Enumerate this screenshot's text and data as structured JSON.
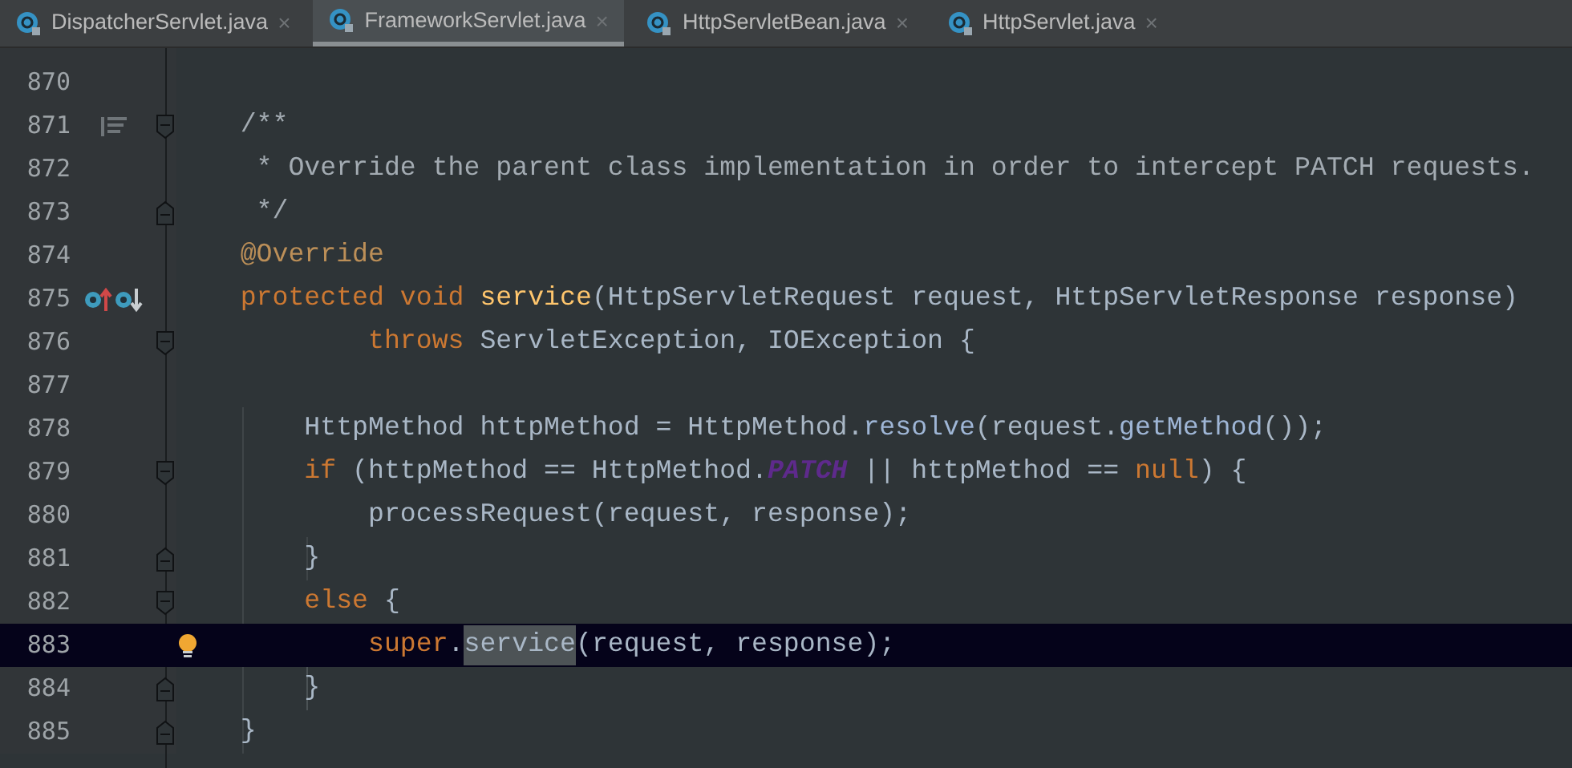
{
  "tabs": [
    {
      "label": "DispatcherServlet.java",
      "selected": false,
      "close": "×"
    },
    {
      "label": "FrameworkServlet.java",
      "selected": true,
      "close": "×"
    },
    {
      "label": "HttpServletBean.java",
      "selected": false,
      "close": "×"
    },
    {
      "label": "HttpServlet.java",
      "selected": false,
      "close": "×"
    }
  ],
  "lines": [
    {
      "number": "870",
      "current": false
    },
    {
      "number": "871",
      "current": false,
      "fold": {
        "kind": "start"
      },
      "gutter_icons": [
        {
          "kind": "doc"
        }
      ],
      "tokens": [
        {
          "text": "    /**",
          "kind": "comment"
        }
      ]
    },
    {
      "number": "872",
      "current": false,
      "tokens": [
        {
          "text": "     * Override the parent class implementation in order to intercept PATCH requests.",
          "kind": "comment"
        }
      ]
    },
    {
      "number": "873",
      "current": false,
      "fold": {
        "kind": "end"
      },
      "tokens": [
        {
          "text": "     */",
          "kind": "comment"
        }
      ]
    },
    {
      "number": "874",
      "current": false,
      "tokens": [
        {
          "text": "    @Override",
          "kind": "annotation"
        }
      ]
    },
    {
      "number": "875",
      "current": false,
      "gutter_icons": [
        {
          "kind": "overriding"
        },
        {
          "kind": "overridden"
        }
      ],
      "tokens": [
        {
          "text": "    protected void ",
          "kind": "keyword"
        },
        {
          "text": "service",
          "kind": "declaration"
        },
        {
          "text": "(HttpServletRequest request, HttpServletResponse response)",
          "kind": "plain"
        }
      ]
    },
    {
      "number": "876",
      "current": false,
      "fold": {
        "kind": "start"
      },
      "tokens": [
        {
          "text": "            throws ",
          "kind": "keyword"
        },
        {
          "text": "ServletException, IOException {",
          "kind": "plain"
        }
      ]
    },
    {
      "number": "877",
      "current": false
    },
    {
      "number": "878",
      "current": false,
      "tokens": [
        {
          "text": "        HttpMethod httpMethod = HttpMethod.",
          "kind": "plain"
        },
        {
          "text": "resolve",
          "kind": "call"
        },
        {
          "text": "(request.",
          "kind": "plain"
        },
        {
          "text": "getMethod",
          "kind": "call"
        },
        {
          "text": "());",
          "kind": "plain"
        }
      ]
    },
    {
      "number": "879",
      "current": false,
      "fold": {
        "kind": "start"
      },
      "tokens": [
        {
          "text": "        if ",
          "kind": "keyword"
        },
        {
          "text": "(httpMethod == HttpMethod.",
          "kind": "plain"
        },
        {
          "text": "PATCH",
          "kind": "constant"
        },
        {
          "text": " || httpMethod == ",
          "kind": "plain"
        },
        {
          "text": "null",
          "kind": "keyword"
        },
        {
          "text": ") {",
          "kind": "plain"
        }
      ]
    },
    {
      "number": "880",
      "current": false,
      "tokens": [
        {
          "text": "            processRequest(request, response);",
          "kind": "plain"
        }
      ]
    },
    {
      "number": "881",
      "current": false,
      "fold": {
        "kind": "end"
      },
      "tokens": [
        {
          "text": "        }",
          "kind": "plain"
        }
      ]
    },
    {
      "number": "882",
      "current": false,
      "fold": {
        "kind": "start"
      },
      "tokens": [
        {
          "text": "        else ",
          "kind": "keyword"
        },
        {
          "text": "{",
          "kind": "plain"
        }
      ]
    },
    {
      "number": "883",
      "current": true,
      "gutter_icons": [
        {
          "kind": "bulb"
        }
      ],
      "tokens": [
        {
          "text": "            super",
          "kind": "keyword"
        },
        {
          "text": ".",
          "kind": "plain"
        },
        {
          "text": "service",
          "kind": "match"
        },
        {
          "text": "(request, response);",
          "kind": "plain"
        }
      ]
    },
    {
      "number": "884",
      "current": false,
      "fold": {
        "kind": "end"
      },
      "tokens": [
        {
          "text": "        }",
          "kind": "plain"
        }
      ]
    },
    {
      "number": "885",
      "current": false,
      "fold": {
        "kind": "end"
      },
      "tokens": [
        {
          "text": "    }",
          "kind": "plain"
        }
      ]
    }
  ]
}
